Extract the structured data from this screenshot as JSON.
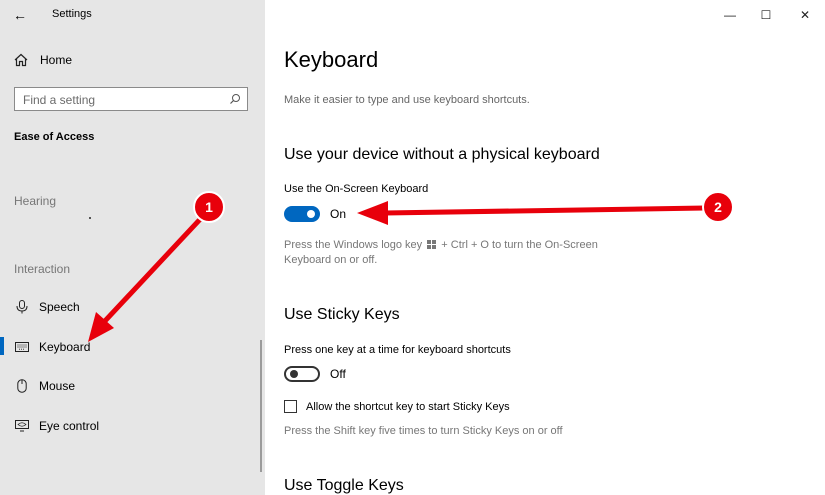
{
  "window": {
    "title": "Settings",
    "back_glyph": "←",
    "minimize_glyph": "—",
    "maximize_glyph": "☐",
    "close_glyph": "✕"
  },
  "sidebar": {
    "home_label": "Home",
    "search_placeholder": "Find a setting",
    "section_title": "Ease of Access",
    "groups": [
      {
        "label": "Hearing"
      },
      {
        "label": "Interaction"
      }
    ],
    "items": [
      {
        "label": "Speech",
        "icon": "microphone-icon"
      },
      {
        "label": "Keyboard",
        "icon": "keyboard-icon",
        "selected": true
      },
      {
        "label": "Mouse",
        "icon": "mouse-icon"
      },
      {
        "label": "Eye control",
        "icon": "eye-control-icon"
      }
    ]
  },
  "main": {
    "page_title": "Keyboard",
    "page_description": "Make it easier to type and use keyboard shortcuts.",
    "sections": [
      {
        "heading": "Use your device without a physical keyboard",
        "setting_label": "Use the On-Screen Keyboard",
        "toggle_state": "On",
        "hint_part1": "Press the Windows logo key",
        "hint_part2": "+ Ctrl + O to turn the On-Screen Keyboard on or off."
      },
      {
        "heading": "Use Sticky Keys",
        "setting_label": "Press one key at a time for keyboard shortcuts",
        "toggle_state": "Off",
        "checkbox_label": "Allow the shortcut key to start Sticky Keys",
        "hint": "Press the Shift key five times to turn Sticky Keys on or off"
      },
      {
        "heading": "Use Toggle Keys"
      }
    ]
  },
  "annotations": [
    {
      "number": "1",
      "color": "#e8000b"
    },
    {
      "number": "2",
      "color": "#e8000b"
    }
  ],
  "colors": {
    "accent": "#0067c0",
    "sidebar_bg": "#e6e6e6",
    "annotation_red": "#e8000b"
  }
}
